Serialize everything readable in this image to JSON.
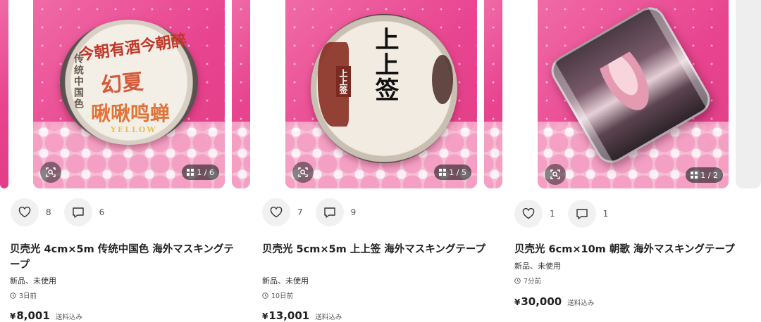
{
  "products": [
    {
      "title": "贝壳光 4cm×5m 传统中国色 海外マスキングテープ",
      "condition": "新品、未使用",
      "time": "3日前",
      "currency": "¥",
      "price": "8,001",
      "shipping": "送料込み",
      "likes": "8",
      "comments": "6",
      "image_count": "1 / 6",
      "artwork_text": [
        "今朝有酒今朝醉",
        "传统中国色",
        "幻夏",
        "啾啾鸣蝉",
        "YELLOW"
      ]
    },
    {
      "title": "贝壳光 5cm×5m 上上签 海外マスキングテープ",
      "condition": "新品、未使用",
      "time": "10日前",
      "currency": "¥",
      "price": "13,001",
      "shipping": "送料込み",
      "likes": "7",
      "comments": "9",
      "image_count": "1 / 5",
      "artwork_text": [
        "上上签",
        "上上签"
      ]
    },
    {
      "title": "贝壳光 6cm×10m 朝歌 海外マスキングテープ",
      "condition": "新品、未使用",
      "time": "7分前",
      "currency": "¥",
      "price": "30,000",
      "shipping": "送料込み",
      "likes": "1",
      "comments": "1",
      "image_count": "1 / 2"
    }
  ],
  "icons": {
    "like": "heart-outline-icon",
    "comment": "speech-bubble-icon",
    "lens": "image-search-icon",
    "time": "clock-icon",
    "gallery": "grid-icon"
  },
  "colors": {
    "pink_background": "#e8448f",
    "text": "#222222",
    "muted": "#555555",
    "button_bg": "#f1f1f1"
  }
}
